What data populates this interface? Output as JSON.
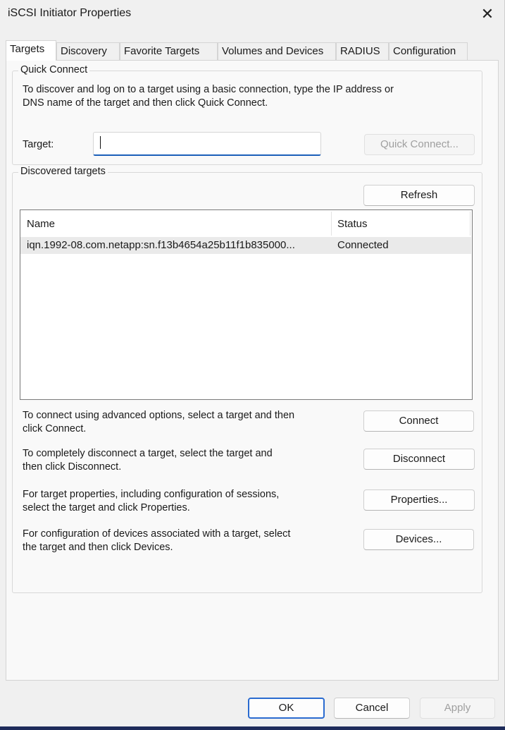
{
  "window": {
    "title": "iSCSI Initiator Properties",
    "close_glyph": "✕"
  },
  "tabs": [
    {
      "label": "Targets",
      "active": true
    },
    {
      "label": "Discovery",
      "active": false
    },
    {
      "label": "Favorite Targets",
      "active": false
    },
    {
      "label": "Volumes and Devices",
      "active": false
    },
    {
      "label": "RADIUS",
      "active": false
    },
    {
      "label": "Configuration",
      "active": false
    }
  ],
  "quick_connect": {
    "group_label": "Quick Connect",
    "description_line1": "To discover and log on to a target using a basic connection, type the IP address or",
    "description_line2": "DNS name of the target and then click Quick Connect.",
    "target_label": "Target:",
    "target_value": "",
    "button_label": "Quick Connect..."
  },
  "discovered": {
    "group_label": "Discovered targets",
    "refresh_label": "Refresh",
    "columns": [
      "Name",
      "Status"
    ],
    "rows": [
      {
        "name": "iqn.1992-08.com.netapp:sn.f13b4654a25b11f1b835000...",
        "status": "Connected",
        "selected": true
      }
    ]
  },
  "actions": [
    {
      "line1": "To connect using advanced options, select a target and then",
      "line2": "click Connect.",
      "button": "Connect"
    },
    {
      "line1": "To completely disconnect a target, select the target and",
      "line2": "then click Disconnect.",
      "button": "Disconnect"
    },
    {
      "line1": "For target properties, including configuration of sessions,",
      "line2": "select the target and click Properties.",
      "button": "Properties..."
    },
    {
      "line1": "For configuration of devices associated with a target, select",
      "line2": "the target and then click Devices.",
      "button": "Devices..."
    }
  ],
  "dialog_buttons": {
    "ok": "OK",
    "cancel": "Cancel",
    "apply": "Apply"
  },
  "colors": {
    "accent": "#1b5fb9",
    "window_bg": "#f0f0f0",
    "selected_row": "#eaeaea"
  }
}
